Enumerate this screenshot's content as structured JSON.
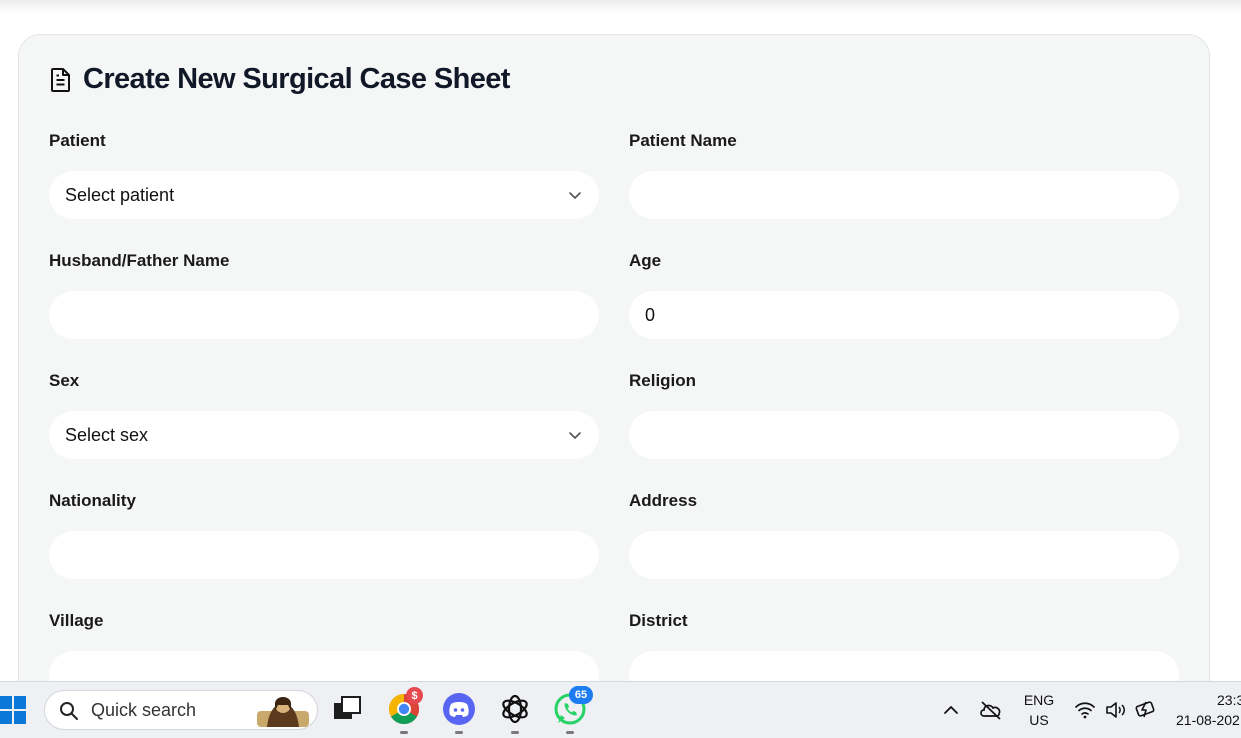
{
  "form": {
    "title": "Create New Surgical Case Sheet",
    "fields": {
      "patient": {
        "label": "Patient",
        "value": "Select patient"
      },
      "patient_name": {
        "label": "Patient Name",
        "value": ""
      },
      "husband_father_name": {
        "label": "Husband/Father Name",
        "value": ""
      },
      "age": {
        "label": "Age",
        "value": "0"
      },
      "sex": {
        "label": "Sex",
        "value": "Select sex"
      },
      "religion": {
        "label": "Religion",
        "value": ""
      },
      "nationality": {
        "label": "Nationality",
        "value": ""
      },
      "address": {
        "label": "Address",
        "value": ""
      },
      "village": {
        "label": "Village",
        "value": ""
      },
      "district": {
        "label": "District",
        "value": ""
      }
    }
  },
  "taskbar": {
    "search_placeholder": "Quick search",
    "apps": [
      {
        "name": "task-view-icon"
      },
      {
        "name": "chrome-icon",
        "badge": "$"
      },
      {
        "name": "discord-icon"
      },
      {
        "name": "chatgpt-icon"
      },
      {
        "name": "whatsapp-icon",
        "badge": "65"
      }
    ],
    "language_line1": "ENG",
    "language_line2": "US",
    "time": "23:3",
    "date": "21-08-202"
  },
  "colors": {
    "card_bg": "#f5f6f6",
    "input_bg": "#ffffff",
    "text": "#111827",
    "discord": "#5865f2",
    "whatsapp": "#25d366",
    "badge_blue": "#1e7cf2",
    "badge_red": "#e5484d"
  }
}
